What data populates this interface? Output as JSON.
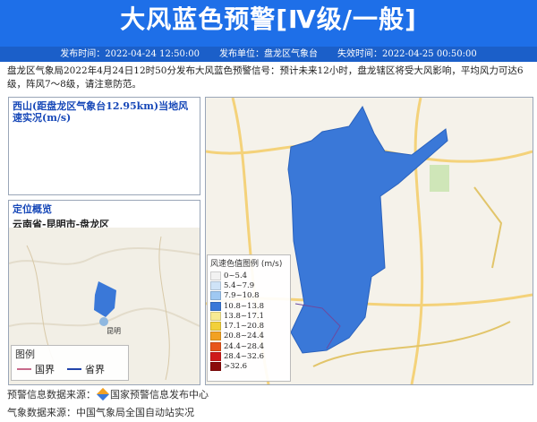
{
  "banner": {
    "title": "大风蓝色预警[Ⅳ级/一般]"
  },
  "meta": {
    "publish_time": "发布时间：2022-04-24 12:50:00",
    "publisher": "发布单位：盘龙区气象台",
    "expire_time": "失效时间：2022-04-25 00:50:00"
  },
  "description": "盘龙区气象局2022年4月24日12时50分发布大风蓝色预警信号：预计未来12小时，盘龙辖区将受大风影响，平均风力可达6级，阵风7～8级，请注意防范。",
  "station_panel": {
    "title": "西山(距盘龙区气象台12.95km)当地风速实况(m/s)"
  },
  "location_panel": {
    "title": "定位概览",
    "region": "云南省-昆明市-盘龙区",
    "city_label": "昆明"
  },
  "location_legend": {
    "title": "图例",
    "items": [
      {
        "label": "国界",
        "color": "#c76a8a"
      },
      {
        "label": "省界",
        "color": "#2244aa"
      }
    ]
  },
  "wind_legend": {
    "title": "风速色值图例 (m/s)",
    "items": [
      {
        "label": "0~5.4",
        "color": "#f2f2f2"
      },
      {
        "label": "5.4~7.9",
        "color": "#cfe3f7"
      },
      {
        "label": "7.9~10.8",
        "color": "#9fc8f2"
      },
      {
        "label": "10.8~13.8",
        "color": "#3a78d8"
      },
      {
        "label": "13.8~17.1",
        "color": "#f7ea93"
      },
      {
        "label": "17.1~20.8",
        "color": "#f2d03a"
      },
      {
        "label": "20.8~24.4",
        "color": "#f2a122"
      },
      {
        "label": "24.4~28.4",
        "color": "#e8551c"
      },
      {
        "label": "28.4~32.6",
        "color": "#cf1a1a"
      },
      {
        "label": ">32.6",
        "color": "#8c0a0a"
      }
    ]
  },
  "footer": {
    "warning_source_label": "预警信息数据来源：",
    "warning_source": "国家预警信息发布中心",
    "weather_source": "气象数据来源：中国气象局全国自动站实况"
  }
}
